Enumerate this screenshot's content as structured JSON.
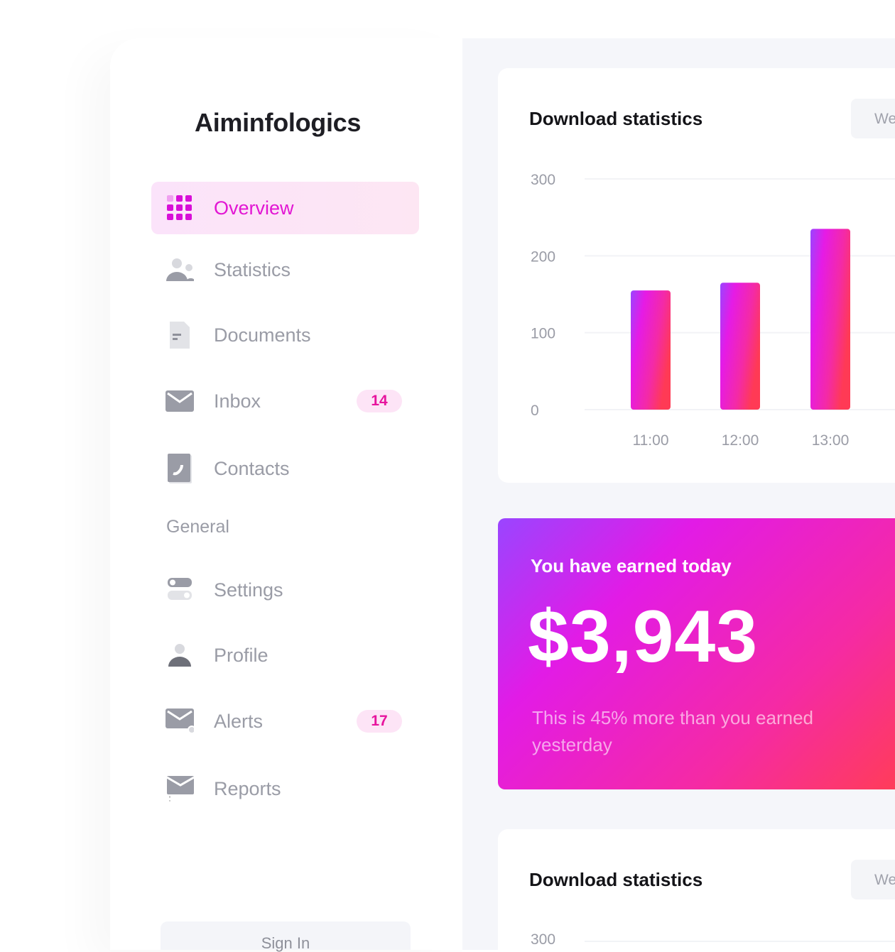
{
  "brand": "Aiminfologics",
  "nav": [
    {
      "label": "Overview",
      "icon": "grid-icon",
      "active": true
    },
    {
      "label": "Statistics",
      "icon": "users-icon"
    },
    {
      "label": "Documents",
      "icon": "document-icon"
    },
    {
      "label": "Inbox",
      "icon": "mail-icon",
      "badge": "14"
    },
    {
      "label": "Contacts",
      "icon": "phone-icon"
    }
  ],
  "section_general": "General",
  "nav_general": [
    {
      "label": "Settings",
      "icon": "toggle-icon"
    },
    {
      "label": "Profile",
      "icon": "user-icon"
    },
    {
      "label": "Alerts",
      "icon": "mail-alert-icon",
      "badge": "17"
    },
    {
      "label": "Reports",
      "icon": "mail-report-icon"
    }
  ],
  "signin_label": "Sign In",
  "colors": {
    "accent": "#e216d3",
    "badge_text": "#e7139d",
    "gradient_start": "#9a45ff",
    "gradient_end": "#ff3c5a"
  },
  "chart_card": {
    "title": "Download statistics",
    "period": "We"
  },
  "chart_data": {
    "type": "bar",
    "categories": [
      "11:00",
      "12:00",
      "13:00"
    ],
    "values": [
      155,
      165,
      235
    ],
    "yticks": [
      0,
      100,
      200,
      300
    ],
    "ylim": [
      0,
      300
    ],
    "grid": true
  },
  "earnings": {
    "title": "You have earned today",
    "amount": "$3,943",
    "subtitle": "This is 45% more than you earned yesterday"
  },
  "chart_card2": {
    "title": "Download statistics",
    "period": "We",
    "ytick_top": "300"
  }
}
